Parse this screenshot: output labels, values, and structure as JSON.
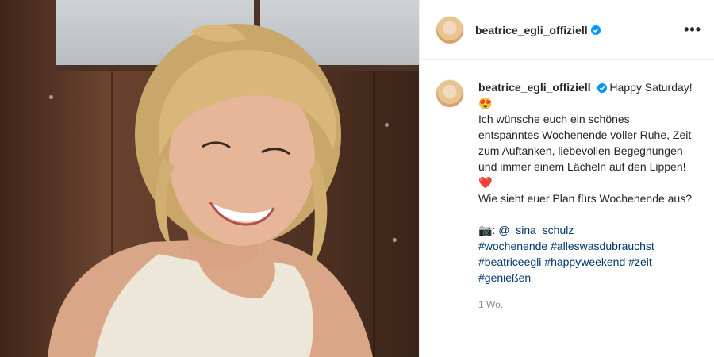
{
  "post": {
    "username": "beatrice_egli_offiziell",
    "verified": true,
    "more_label": "•••",
    "caption": {
      "intro": "Happy Saturday!",
      "intro_emoji": "😍",
      "line1": "Ich wünsche euch ein schönes entspanntes Wochenende voller Ruhe, Zeit zum Auftanken, liebevollen Begegnungen und immer einem Lächeln auf den Lippen!",
      "line1_emoji": "❤️",
      "line2": "Wie sieht euer Plan fürs Wochenende aus?",
      "camera_emoji": "📷",
      "credit_prefix": ":",
      "credit_mention": "@_sina_schulz_"
    },
    "hashtags": [
      "#wochenende",
      "#alleswasdubrauchst",
      "#beatriceegli",
      "#happyweekend",
      "#zeit",
      "#genießen"
    ],
    "timestamp": "1 Wo."
  },
  "colors": {
    "link": "#00376b",
    "verified_badge": "#0095f6",
    "text": "#262626",
    "muted": "#8e8e8e"
  },
  "icons": {
    "verified": "verified-badge-icon",
    "more": "more-options-icon"
  }
}
